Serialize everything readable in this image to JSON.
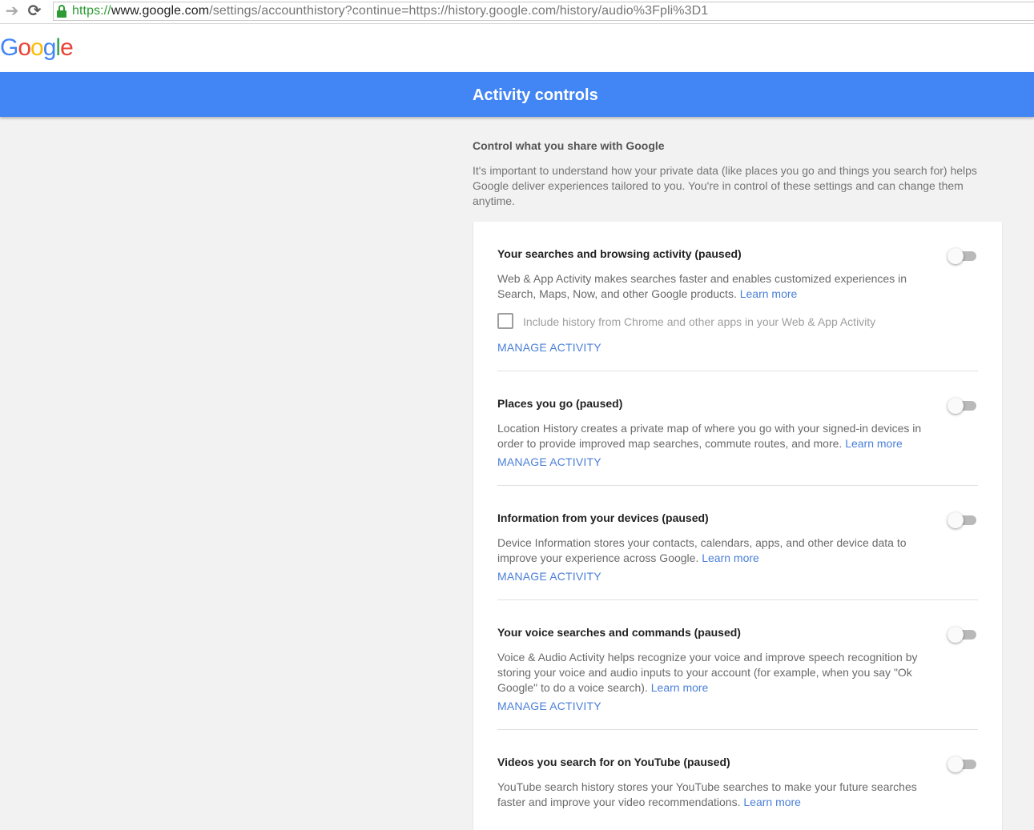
{
  "browser": {
    "url_scheme": "https://",
    "url_host": "www.google.com",
    "url_path": "/settings/accounthistory?continue=https://history.google.com/history/audio%3Fpli%3D1"
  },
  "header": {
    "logo_letters": [
      {
        "char": "G",
        "color": "#4285f4"
      },
      {
        "char": "o",
        "color": "#ea4335"
      },
      {
        "char": "o",
        "color": "#fbbc05"
      },
      {
        "char": "g",
        "color": "#4285f4"
      },
      {
        "char": "l",
        "color": "#34a853"
      },
      {
        "char": "e",
        "color": "#ea4335"
      }
    ]
  },
  "page": {
    "title": "Activity controls",
    "intro_heading": "Control what you share with Google",
    "intro_text": "It's important to understand how your private data (like places you go and things you search for) helps Google deliver experiences tailored to you. You're in control of these settings and can change them anytime."
  },
  "sections": [
    {
      "title": "Your searches and browsing activity (paused)",
      "description": "Web & App Activity makes searches faster and enables customized experiences in Search, Maps, Now, and other Google products.",
      "learn_more": "Learn more",
      "checkbox_label": "Include history from Chrome and other apps in your Web & App Activity",
      "manage": "MANAGE ACTIVITY",
      "enabled": false
    },
    {
      "title": "Places you go (paused)",
      "description": "Location History creates a private map of where you go with your signed-in devices in order to provide improved map searches, commute routes, and more.",
      "learn_more": "Learn more",
      "manage": "MANAGE ACTIVITY",
      "enabled": false
    },
    {
      "title": "Information from your devices (paused)",
      "description": "Device Information stores your contacts, calendars, apps, and other device data to improve your experience across Google.",
      "learn_more": "Learn more",
      "manage": "MANAGE ACTIVITY",
      "enabled": false
    },
    {
      "title": "Your voice searches and commands (paused)",
      "description": "Voice & Audio Activity helps recognize your voice and improve speech recognition by storing your voice and audio inputs to your account (for example, when you say \"Ok Google\" to do a voice search).",
      "learn_more": "Learn more",
      "manage": "MANAGE ACTIVITY",
      "enabled": false
    },
    {
      "title": "Videos you search for on YouTube (paused)",
      "description": "YouTube search history stores your YouTube searches to make your future searches faster and improve your video recommendations.",
      "learn_more": "Learn more",
      "enabled": false
    }
  ]
}
